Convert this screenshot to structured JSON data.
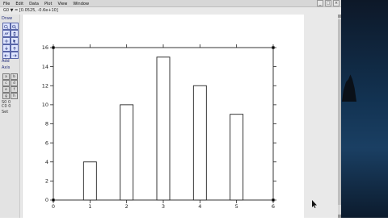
{
  "window": {
    "title": "File Edit Data Plot View Window",
    "minimize": "_",
    "maximize": "□",
    "close": "×"
  },
  "menus": [
    "File",
    "Edit",
    "Data",
    "Plot",
    "View",
    "Window"
  ],
  "coordinates": {
    "text": "G0 ▼ = [0.0525, -0.6e+10]"
  },
  "left_panel": {
    "group1": "Draw",
    "group2": "Add",
    "group3": "Axis",
    "button_labels": [
      "a",
      "b",
      "c",
      "d",
      "e",
      "f",
      "g",
      "h"
    ],
    "status1": "S0 0",
    "status2": "C0 0",
    "status3": "Set"
  },
  "chart_data": {
    "type": "bar",
    "categories": [
      "1",
      "2",
      "3",
      "4",
      "5"
    ],
    "x": [
      1,
      2,
      3,
      4,
      5
    ],
    "values": [
      4,
      10,
      15,
      12,
      9
    ],
    "xlim": [
      0,
      6
    ],
    "ylim": [
      0,
      16
    ],
    "x_ticks": [
      0,
      1,
      2,
      3,
      4,
      5,
      6
    ],
    "y_ticks": [
      0,
      2,
      4,
      6,
      8,
      10,
      12,
      14,
      16
    ],
    "grid": false,
    "bar_fill": "#ffffff",
    "bar_stroke": "#222222"
  }
}
